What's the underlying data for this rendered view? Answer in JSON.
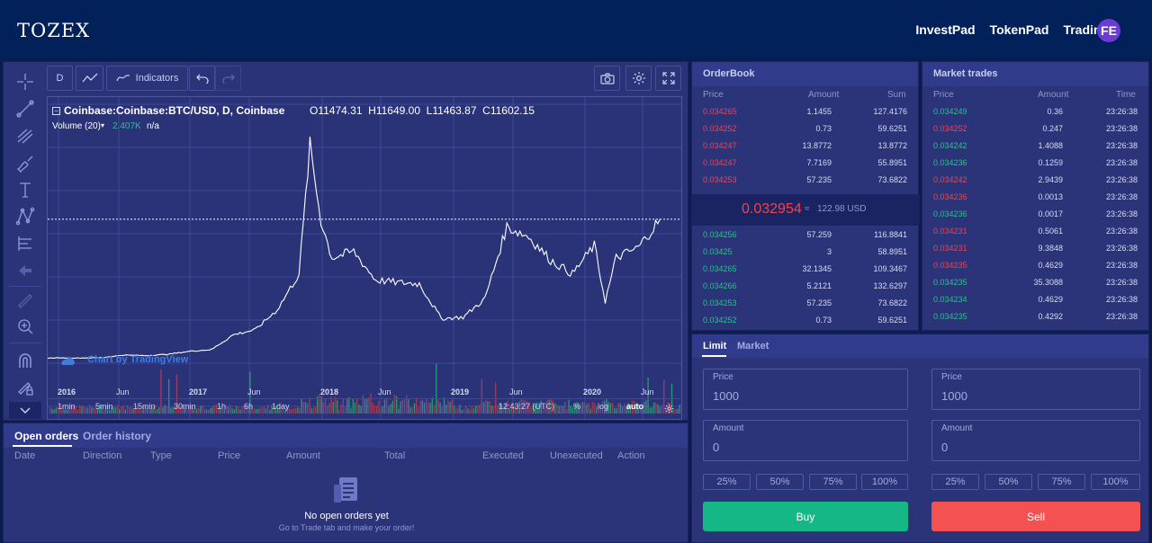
{
  "header": {
    "logo": "TOZEX",
    "nav": [
      "InvestPad",
      "TokenPad",
      "Trading"
    ],
    "avatar": "FE"
  },
  "chart": {
    "toolbar": {
      "interval": "D",
      "indicators": "Indicators"
    },
    "legend": {
      "symbol": "Coinbase:Coinbase:BTC/USD, D, Coinbase",
      "ohlc": "O11474.31  H11649.00  L11463.87  C11602.15",
      "volume_label": "Volume (20)",
      "volume_value": "2.407K",
      "volume_na": "n/a"
    },
    "watermark": "Chart by TradingView",
    "x_ticks": [
      "2016",
      "Jun",
      "2017",
      "Jun",
      "2018",
      "Jun",
      "2019",
      "Jun",
      "2020",
      "Jun"
    ],
    "timeframes": [
      "1min",
      "5min",
      "15min",
      "30min",
      "1h",
      "6h",
      "1day"
    ],
    "clock": "12:43:27 (UTC)",
    "scale_buttons": [
      "%",
      "log",
      "auto"
    ]
  },
  "chart_data": {
    "type": "line",
    "title": "Coinbase:Coinbase:BTC/USD, D, Coinbase",
    "x": [
      "2015-11",
      "2016-01",
      "2016-03",
      "2016-05",
      "2016-07",
      "2016-09",
      "2016-11",
      "2017-01",
      "2017-03",
      "2017-05",
      "2017-07",
      "2017-09",
      "2017-11",
      "2017-12",
      "2018-01",
      "2018-02",
      "2018-04",
      "2018-06",
      "2018-08",
      "2018-10",
      "2018-12",
      "2019-02",
      "2019-04",
      "2019-06",
      "2019-08",
      "2019-10",
      "2019-12",
      "2020-02",
      "2020-03",
      "2020-04",
      "2020-06",
      "2020-08"
    ],
    "series": [
      {
        "values": [
          380,
          430,
          420,
          450,
          660,
          610,
          720,
          960,
          1100,
          2300,
          2700,
          4300,
          7200,
          17500,
          11500,
          8500,
          9000,
          6700,
          6500,
          6400,
          3600,
          3700,
          5200,
          11000,
          10200,
          8300,
          7200,
          9500,
          5000,
          8500,
          9300,
          11602
        ]
      }
    ],
    "last_price_line": 11600
  },
  "orderbook": {
    "title": "OrderBook",
    "columns": [
      "Price",
      "Amount",
      "Sum"
    ],
    "asks": [
      [
        "0.034265",
        "1.1455",
        "127.4176"
      ],
      [
        "0.034252",
        "0.73",
        "59.6251"
      ],
      [
        "0.034247",
        "13.8772",
        "13.8772"
      ],
      [
        "0.034247",
        "7.7169",
        "55.8951"
      ],
      [
        "0.034253",
        "57.235",
        "73.6822"
      ]
    ],
    "last_price": "0.032954",
    "approx_sign": "≈",
    "last_price_usd": "122.98 USD",
    "bids": [
      [
        "0.034256",
        "57.259",
        "116.8841"
      ],
      [
        "0.03425",
        "3",
        "58.8951"
      ],
      [
        "0.034265",
        "32.1345",
        "109.3467"
      ],
      [
        "0.034266",
        "5.2121",
        "132.6297"
      ],
      [
        "0.034253",
        "57.235",
        "73.6822"
      ],
      [
        "0.034252",
        "0.73",
        "59.6251"
      ]
    ]
  },
  "market_trades": {
    "title": "Market trades",
    "columns": [
      "Price",
      "Amount",
      "Time"
    ],
    "rows": [
      {
        "price": "0.034249",
        "amount": "0.36",
        "time": "23:26:38",
        "side": "buy"
      },
      {
        "price": "0.034252",
        "amount": "0.247",
        "time": "23:26:38",
        "side": "sell"
      },
      {
        "price": "0.034242",
        "amount": "1.4088",
        "time": "23:26:38",
        "side": "buy"
      },
      {
        "price": "0.034236",
        "amount": "0.1259",
        "time": "23:26:38",
        "side": "buy"
      },
      {
        "price": "0.034242",
        "amount": "2.9439",
        "time": "23:26:38",
        "side": "sell"
      },
      {
        "price": "0.034236",
        "amount": "0.0013",
        "time": "23:26:38",
        "side": "sell"
      },
      {
        "price": "0.034236",
        "amount": "0.0017",
        "time": "23:26:38",
        "side": "buy"
      },
      {
        "price": "0.034231",
        "amount": "0.5061",
        "time": "23:26:38",
        "side": "sell"
      },
      {
        "price": "0.034231",
        "amount": "9.3848",
        "time": "23:26:38",
        "side": "sell"
      },
      {
        "price": "0.034235",
        "amount": "0.4629",
        "time": "23:26:38",
        "side": "sell"
      },
      {
        "price": "0.034235",
        "amount": "35.3088",
        "time": "23:26:38",
        "side": "buy"
      },
      {
        "price": "0.034234",
        "amount": "0.4629",
        "time": "23:26:38",
        "side": "buy"
      },
      {
        "price": "0.034235",
        "amount": "0.4292",
        "time": "23:26:38",
        "side": "buy"
      }
    ]
  },
  "order_form": {
    "tabs": [
      "Limit",
      "Market"
    ],
    "price_label": "Price",
    "amount_label": "Amount",
    "buy_price": "1000",
    "sell_price": "1000",
    "buy_amount": "0",
    "sell_amount": "0",
    "percents": [
      "25%",
      "50%",
      "75%",
      "100%"
    ],
    "buy_label": "Buy",
    "sell_label": "Sell",
    "buy_color": "#16b786",
    "sell_color": "#f45152"
  },
  "orders": {
    "tabs": [
      "Open orders",
      "Order history"
    ],
    "columns": [
      "Date",
      "Direction",
      "Type",
      "Price",
      "Amount",
      "Total",
      "Executed",
      "Unexecuted",
      "Action"
    ],
    "empty_title": "No open orders yet",
    "empty_sub": "Go to Trade tab and make your order!"
  }
}
